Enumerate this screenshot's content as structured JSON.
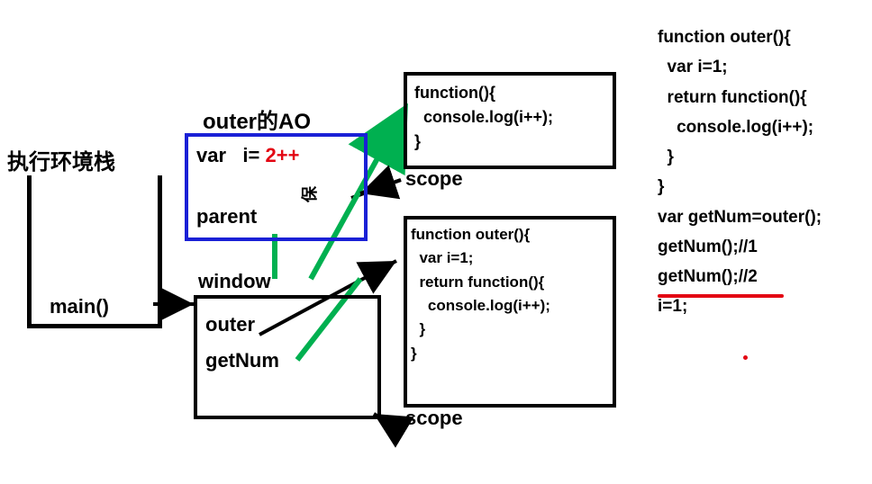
{
  "title": "执行环境栈",
  "stack": {
    "main": "main()"
  },
  "ao": {
    "title": "outer的AO",
    "var_label": "var",
    "var_name": "i=",
    "var_value": "2++",
    "parent": "parent",
    "hold_note": "保"
  },
  "windowBox": {
    "window": "window",
    "outer": "outer",
    "getNum": "getNum"
  },
  "innerFn": {
    "l1": "function(){",
    "l2": "  console.log(i++);",
    "l3": "}",
    "scope": "scope"
  },
  "outerFn": {
    "l1": "function outer(){",
    "l2": "  var i=1;",
    "l3": "  return function(){",
    "l4": "    console.log(i++);",
    "l5": "  }",
    "l6": "}",
    "scope": "scope"
  },
  "sourceCode": {
    "l1": "function outer(){",
    "l2": "  var i=1;",
    "l3": "  return function(){",
    "l4": "    console.log(i++);",
    "l5": "  }",
    "l6": "}",
    "l7": "var getNum=outer();",
    "l8": "getNum();//1",
    "l9": "getNum();//2",
    "l10": "i=1;"
  },
  "colors": {
    "black": "#000000",
    "blue": "#1a20d6",
    "green": "#00b050",
    "red": "#e30613"
  }
}
